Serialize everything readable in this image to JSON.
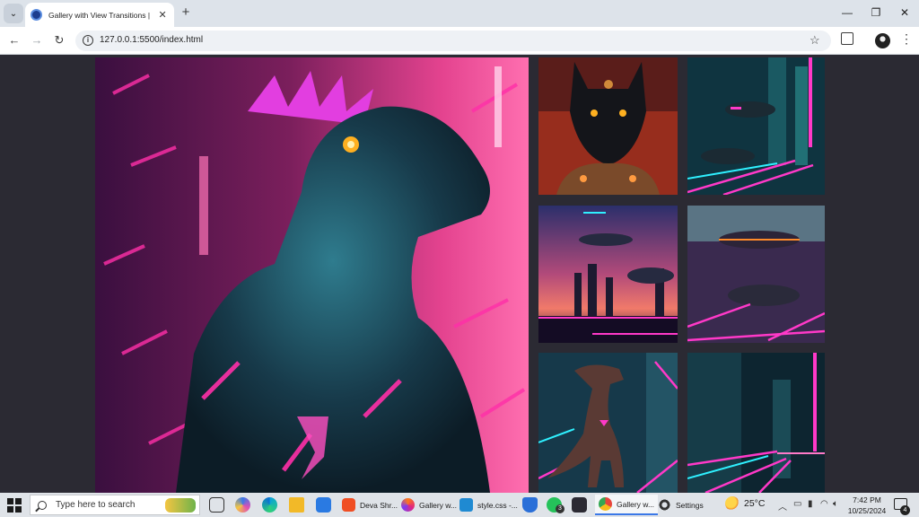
{
  "browser": {
    "tab": {
      "title": "Gallery with View Transitions | Blue"
    },
    "address": {
      "url": "127.0.0.1:5500/index.html"
    },
    "window_controls": {
      "minimize": "—",
      "restore": "❐",
      "close": "✕"
    }
  },
  "gallery": {
    "images": [
      {
        "name": "neon-dinosaur-portrait"
      },
      {
        "name": "cyber-wolf"
      },
      {
        "name": "neon-city-flying-cars"
      },
      {
        "name": "sunset-skyline-flying-cars"
      },
      {
        "name": "flying-car-neon-street"
      },
      {
        "name": "neon-t-rex"
      },
      {
        "name": "neon-street-tunnel"
      }
    ]
  },
  "taskbar": {
    "search_placeholder": "Type here to search",
    "apps": [
      {
        "label": "Deva Shr..."
      },
      {
        "label": "Gallery w..."
      },
      {
        "label": "style.css -..."
      },
      {
        "label": "Gallery w..."
      },
      {
        "label": "Settings"
      }
    ],
    "whatsapp_badge": "3",
    "weather": {
      "temp": "25°C"
    },
    "clock": {
      "time": "7:42 PM",
      "date": "10/25/2024"
    },
    "notifications_badge": "4"
  },
  "colors": {
    "accent": "#3b78e7",
    "page_bg": "#2b2a33",
    "neon_pink": "#ff2fa8",
    "neon_cyan": "#27e6f2"
  }
}
